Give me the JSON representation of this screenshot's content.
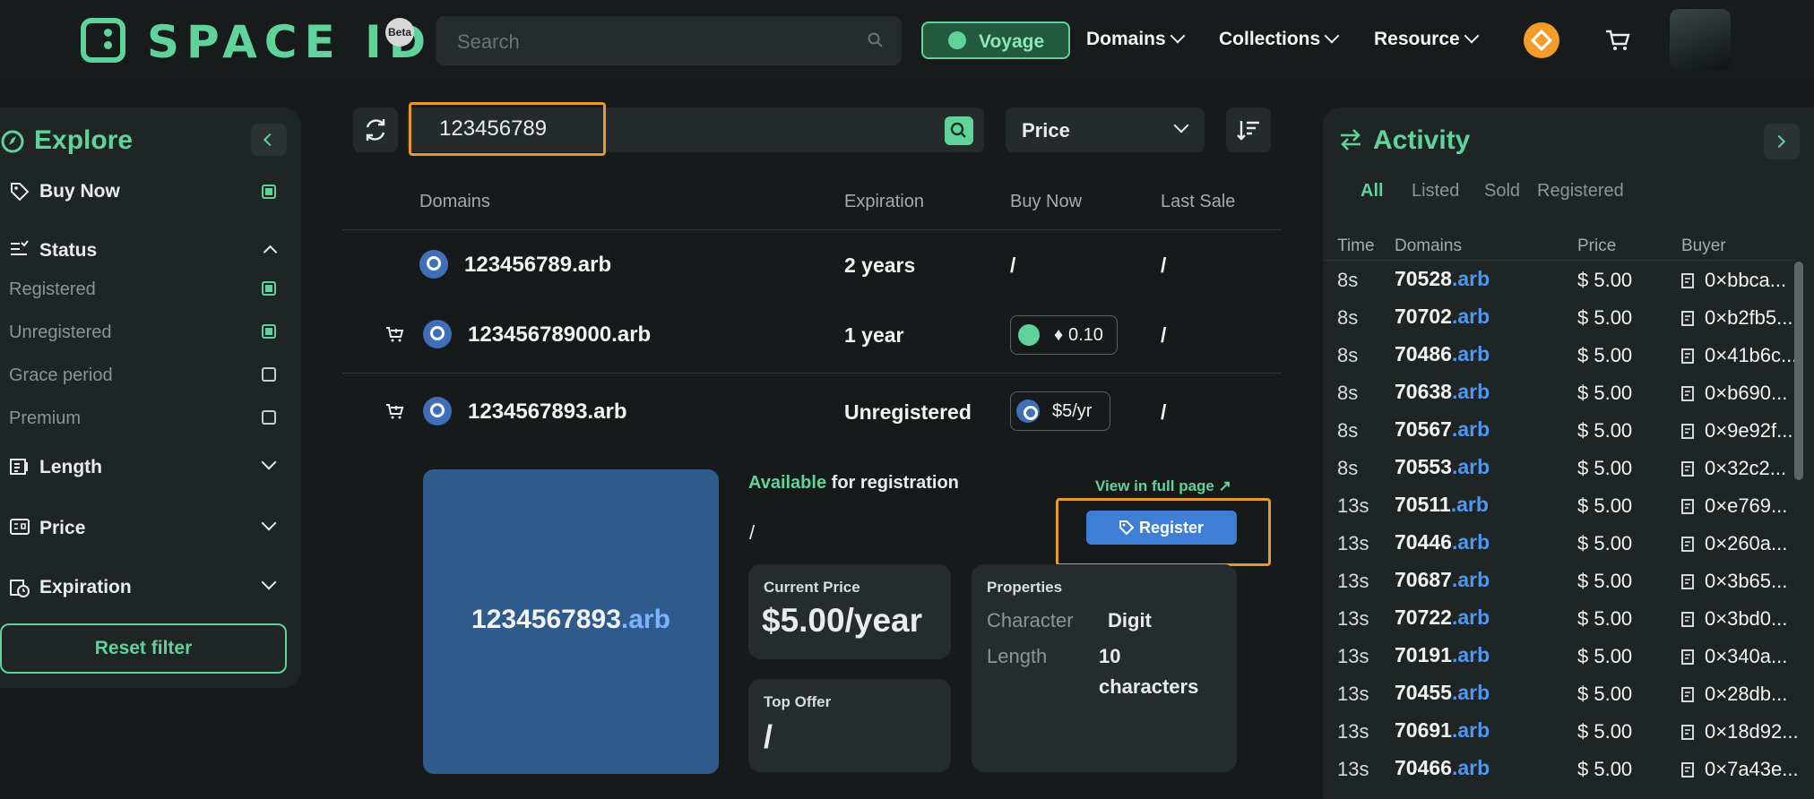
{
  "header": {
    "brand": "SPACE ID",
    "beta_badge": "Beta",
    "search_placeholder": "Search",
    "voyage_label": "Voyage",
    "nav": [
      "Domains",
      "Collections",
      "Resource"
    ]
  },
  "filters": {
    "title": "Explore",
    "buy_now": "Buy Now",
    "status_label": "Status",
    "status_options": [
      {
        "label": "Registered",
        "checked": true
      },
      {
        "label": "Unregistered",
        "checked": true
      },
      {
        "label": "Grace period",
        "checked": false
      },
      {
        "label": "Premium",
        "checked": false
      }
    ],
    "length": "Length",
    "price": "Price",
    "expiration": "Expiration",
    "reset": "Reset filter"
  },
  "results": {
    "search_value": "123456789",
    "sort_label": "Price",
    "columns": [
      "Domains",
      "Expiration",
      "Buy Now",
      "Last Sale"
    ],
    "rows": [
      {
        "domain": "123456789.arb",
        "expiration": "2 years",
        "buy_now": "/",
        "last_sale": "/"
      },
      {
        "domain": "123456789000.arb",
        "expiration": "1 year",
        "buy_now": "0.10",
        "last_sale": "/"
      },
      {
        "domain": "1234567893.arb",
        "expiration": "Unregistered",
        "buy_now": "$5/yr",
        "last_sale": "/"
      }
    ]
  },
  "detail": {
    "name": "1234567893",
    "tld": ".arb",
    "available_word": "Available",
    "available_rest": "for registration",
    "slash": "/",
    "view_full": "View in full page ↗",
    "register": "Register",
    "current_price_label": "Current Price",
    "current_price": "$5.00/year",
    "top_offer_label": "Top Offer",
    "top_offer": "/",
    "properties_label": "Properties",
    "character_label": "Character",
    "character_value": "Digit",
    "length_label": "Length",
    "length_value_1": "10",
    "length_value_2": "characters"
  },
  "activity": {
    "title": "Activity",
    "tabs": [
      "All",
      "Listed",
      "Sold",
      "Registered"
    ],
    "columns": [
      "Time",
      "Domains",
      "Price",
      "Buyer"
    ],
    "rows": [
      {
        "time": "8s",
        "name": "70528",
        "tld": ".arb",
        "price": "$ 5.00",
        "buyer": "0×bbca..."
      },
      {
        "time": "8s",
        "name": "70702",
        "tld": ".arb",
        "price": "$ 5.00",
        "buyer": "0×b2fb5..."
      },
      {
        "time": "8s",
        "name": "70486",
        "tld": ".arb",
        "price": "$ 5.00",
        "buyer": "0×41b6c..."
      },
      {
        "time": "8s",
        "name": "70638",
        "tld": ".arb",
        "price": "$ 5.00",
        "buyer": "0×b690..."
      },
      {
        "time": "8s",
        "name": "70567",
        "tld": ".arb",
        "price": "$ 5.00",
        "buyer": "0×9e92f..."
      },
      {
        "time": "8s",
        "name": "70553",
        "tld": ".arb",
        "price": "$ 5.00",
        "buyer": "0×32c2..."
      },
      {
        "time": "13s",
        "name": "70511",
        "tld": ".arb",
        "price": "$ 5.00",
        "buyer": "0×e769..."
      },
      {
        "time": "13s",
        "name": "70446",
        "tld": ".arb",
        "price": "$ 5.00",
        "buyer": "0×260a..."
      },
      {
        "time": "13s",
        "name": "70687",
        "tld": ".arb",
        "price": "$ 5.00",
        "buyer": "0×3b65..."
      },
      {
        "time": "13s",
        "name": "70722",
        "tld": ".arb",
        "price": "$ 5.00",
        "buyer": "0×3bd0..."
      },
      {
        "time": "13s",
        "name": "70191",
        "tld": ".arb",
        "price": "$ 5.00",
        "buyer": "0×340a..."
      },
      {
        "time": "13s",
        "name": "70455",
        "tld": ".arb",
        "price": "$ 5.00",
        "buyer": "0×28db..."
      },
      {
        "time": "13s",
        "name": "70691",
        "tld": ".arb",
        "price": "$ 5.00",
        "buyer": "0×18d92..."
      },
      {
        "time": "13s",
        "name": "70466",
        "tld": ".arb",
        "price": "$ 5.00",
        "buyer": "0×7a43e..."
      }
    ]
  }
}
